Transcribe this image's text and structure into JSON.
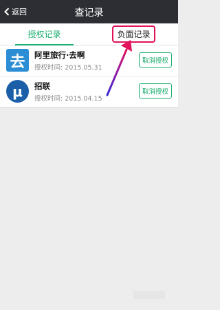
{
  "header": {
    "back_label": "返回",
    "title": "查记录"
  },
  "tabs": [
    {
      "label": "授权记录",
      "active": true
    },
    {
      "label": "负面记录",
      "active": false
    }
  ],
  "accent_color": "#1aad6d",
  "highlight_color": "#e1115b",
  "records": [
    {
      "icon": "去",
      "icon_name": "qunar-logo-icon",
      "name": "阿里旅行·去啊",
      "time": "授权时间: 2015.05.31",
      "action": "取消授权"
    },
    {
      "icon": "μ",
      "icon_name": "zhaolian-logo-icon",
      "name": "招联",
      "time": "授权时间: 2015.04.15",
      "action": "取消授权"
    }
  ]
}
